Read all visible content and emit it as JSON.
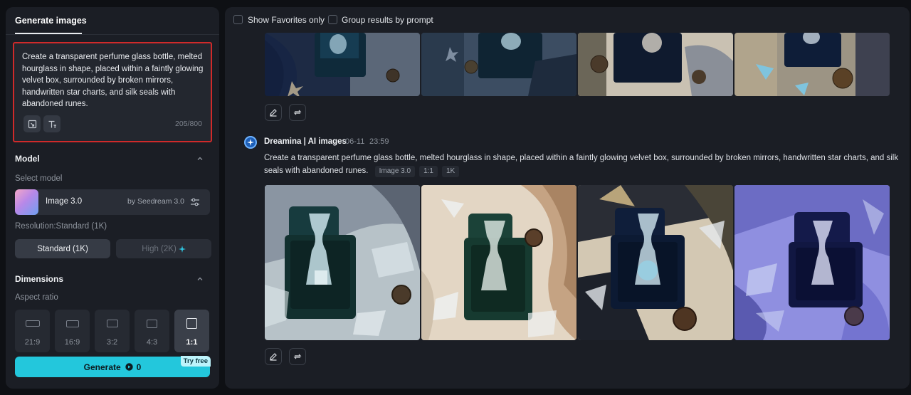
{
  "left_panel": {
    "tab_label": "Generate images",
    "prompt_text": "Create a transparent perfume glass bottle, melted hourglass in shape, placed within a faintly glowing velvet box, surrounded by broken mirrors, handwritten star charts, and silk seals with abandoned runes.",
    "char_count": "205/800",
    "model_section": {
      "title": "Model",
      "select_label": "Select model",
      "model_name": "Image 3.0",
      "model_by": "by Seedream 3.0"
    },
    "resolution": {
      "label": "Resolution:Standard (1K)",
      "standard_label": "Standard (1K)",
      "high_label": "High (2K)"
    },
    "dimensions": {
      "title": "Dimensions",
      "aspect_label": "Aspect ratio",
      "ratios": [
        "21:9",
        "16:9",
        "3:2",
        "4:3",
        "1:1"
      ],
      "selected": "1:1"
    },
    "generate": {
      "label": "Generate",
      "cost": "0",
      "badge": "Try free",
      "color": "#23c7dc"
    }
  },
  "right_panel": {
    "show_favorites_label": "Show Favorites only",
    "group_results_label": "Group results by prompt",
    "generation": {
      "author": "Dreamina | AI images",
      "date": "06-11",
      "time": "23:59",
      "prompt": "Create a transparent perfume glass bottle, melted hourglass in shape, placed within a faintly glowing velvet box, surrounded by broken mirrors, handwritten star charts, and silk seals with abandoned runes.",
      "tags": [
        "Image 3.0",
        "1:1",
        "1K"
      ]
    }
  },
  "icons": [
    "canvas-icon",
    "text-format-icon",
    "chevron-up-icon",
    "settings-sliders-icon",
    "sparkle-icon",
    "coin-icon",
    "edit-pencil-icon",
    "regenerate-icon",
    "dreamina-logo-icon"
  ]
}
